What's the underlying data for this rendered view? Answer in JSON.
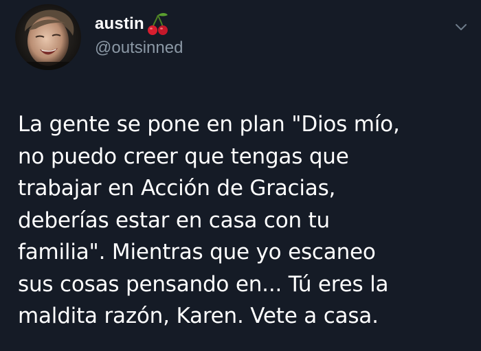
{
  "user": {
    "display_name": "austin",
    "name_emoji": "cherries-icon",
    "handle": "@outsinned"
  },
  "menu": {
    "icon": "chevron-down-icon"
  },
  "tweet": {
    "text": "La gente se pone en plan \"Dios mío,\nno puedo creer que tengas que\ntrabajar en Acción de Gracias,\ndeberías estar en casa con tu\nfamilia\". Mientras que yo escaneo\nsus cosas pensando en... Tú eres la\nmaldita razón, Karen. Vete a casa."
  },
  "colors": {
    "background": "#151b26",
    "text": "#ffffff",
    "secondary_text": "#8b98a5",
    "cherry_red": "#d81e2f",
    "leaf_green": "#5a9e2f"
  }
}
